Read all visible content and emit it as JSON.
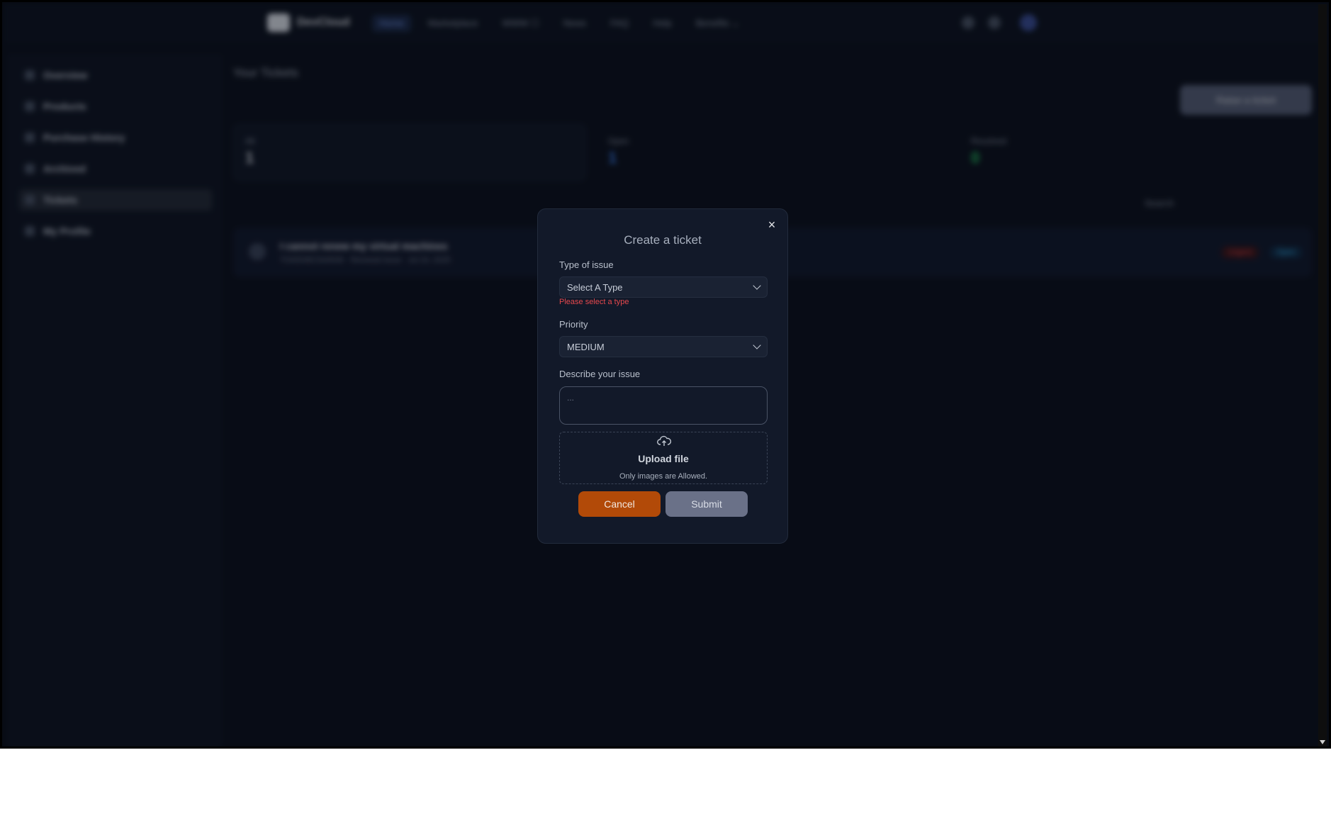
{
  "nav": {
    "brand": "DevCloud",
    "links": [
      "Home",
      "Marketplace",
      "WWW ☐",
      "News",
      "FAQ",
      "Help",
      "Benefits ⌄"
    ]
  },
  "sidebar": {
    "items": [
      {
        "label": "Overview"
      },
      {
        "label": "Products"
      },
      {
        "label": "Purchase History"
      },
      {
        "label": "Archived"
      },
      {
        "label": "Tickets"
      },
      {
        "label": "My Profile"
      }
    ]
  },
  "main": {
    "heading": "Your Tickets",
    "raise_button": "Raise a ticket",
    "stats": [
      {
        "label": "All",
        "value": "1"
      },
      {
        "label": "Open",
        "value": "1"
      },
      {
        "label": "Resolved",
        "value": "0"
      }
    ],
    "search_placeholder": "Search",
    "ticket": {
      "title": "I cannot renew my virtual machines",
      "meta": "TOKEN8C5A9008 · Renewal issue · Jul 24, 2025",
      "priority_badge": "Urgent",
      "status_badge": "Open"
    }
  },
  "modal": {
    "title": "Create a ticket",
    "close_icon": "×",
    "type_label": "Type of issue",
    "type_value": "Select A Type",
    "type_error": "Please select a type",
    "priority_label": "Priority",
    "priority_value": "MEDIUM",
    "describe_label": "Describe your issue",
    "describe_placeholder": "...",
    "upload_title": "Upload file",
    "upload_sub": "Only images are Allowed.",
    "cancel_label": "Cancel",
    "submit_label": "Submit"
  },
  "colors": {
    "cancel_button": "#b24a08",
    "submit_button": "#6a7188",
    "error": "#e5484d",
    "background": "#0a0f1a"
  }
}
